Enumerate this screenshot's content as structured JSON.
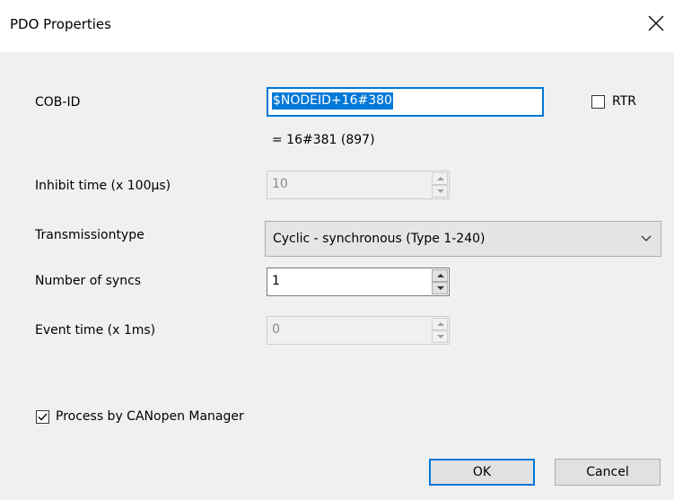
{
  "dialog": {
    "title": "PDO Properties",
    "close_icon": "close-icon"
  },
  "cob_id": {
    "label": "COB-ID",
    "value": "$NODEID+16#380",
    "computed": "= 16#381 (897)",
    "rtr_label": "RTR",
    "rtr_checked": false
  },
  "inhibit_time": {
    "label": "Inhibit time (x 100µs)",
    "value": "10"
  },
  "transmission_type": {
    "label": "Transmissiontype",
    "value": "Cyclic - synchronous (Type 1-240)"
  },
  "number_of_syncs": {
    "label": "Number of syncs",
    "value": "1"
  },
  "event_time": {
    "label": "Event time (x 1ms)",
    "value": "0"
  },
  "process_by_manager": {
    "label": "Process by CANopen Manager",
    "checked": true
  },
  "buttons": {
    "ok": "OK",
    "cancel": "Cancel"
  },
  "colors": {
    "accent": "#0078d7",
    "background": "#f0f0f0"
  }
}
